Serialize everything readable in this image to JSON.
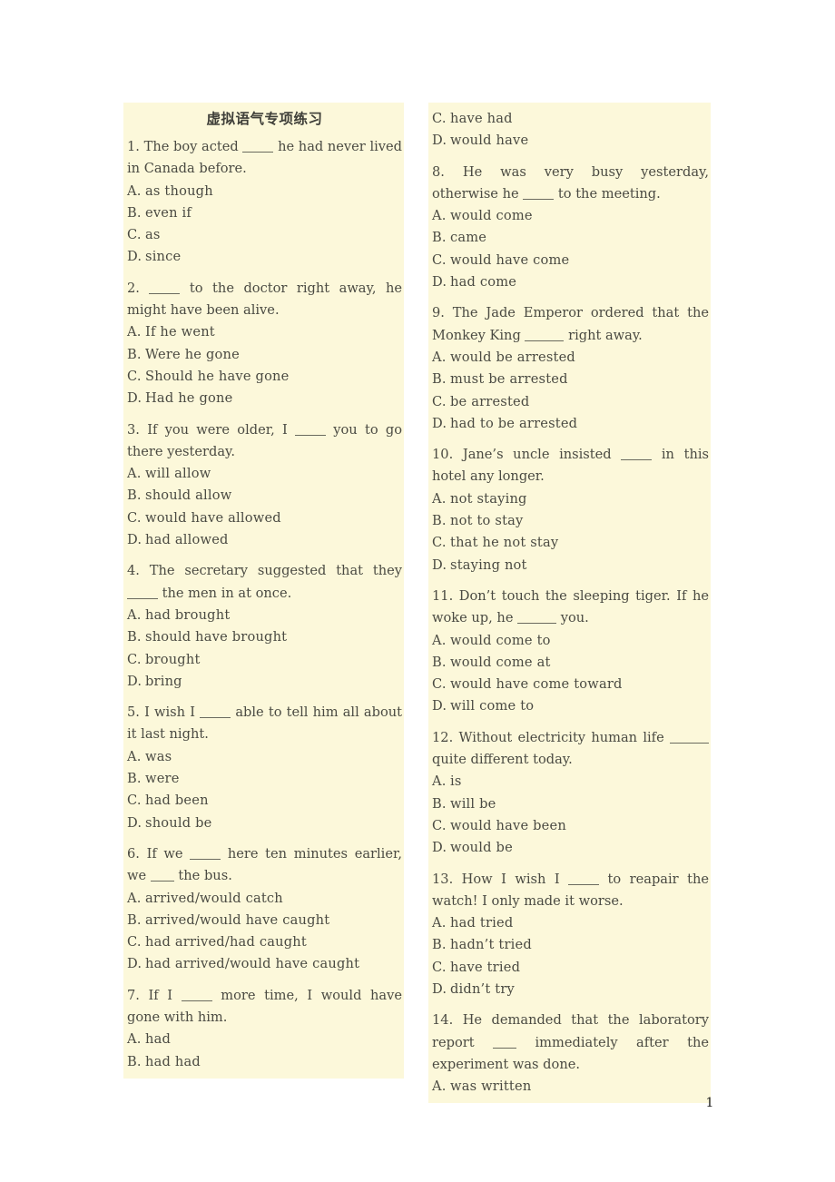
{
  "document": {
    "title": "虚拟语气专项练习",
    "page_number": "1",
    "tint_color": "#fcf8da",
    "text_color": "#4a4a42"
  },
  "columns": {
    "left": {
      "questions": [
        {
          "number": "1.",
          "stem_before": "The boy acted ",
          "blank": "w4",
          "stem_after": " he had never lived in Canada before.",
          "options": [
            {
              "letter": "A.",
              "text": "as though"
            },
            {
              "letter": "B.",
              "text": "even if"
            },
            {
              "letter": "C.",
              "text": "as"
            },
            {
              "letter": "D.",
              "text": "since"
            }
          ]
        },
        {
          "number": "2.",
          "stem_before": "",
          "blank": "w4",
          "stem_after": " to the doctor right away, he might have been alive.",
          "options": [
            {
              "letter": "A.",
              "text": "If he went"
            },
            {
              "letter": "B.",
              "text": "Were he gone"
            },
            {
              "letter": "C.",
              "text": "Should he have gone"
            },
            {
              "letter": "D.",
              "text": "Had he gone"
            }
          ]
        },
        {
          "number": "3.",
          "stem_before": "If you were older, I ",
          "blank": "w4",
          "stem_after": " you to go there yesterday.",
          "options": [
            {
              "letter": "A.",
              "text": "will allow"
            },
            {
              "letter": "B.",
              "text": "should allow"
            },
            {
              "letter": "C.",
              "text": "would have allowed"
            },
            {
              "letter": "D.",
              "text": "had allowed"
            }
          ]
        },
        {
          "number": "4.",
          "stem_before": "The secretary suggested that they ",
          "blank": "w4",
          "stem_after": " the men in at once.",
          "options": [
            {
              "letter": "A.",
              "text": "had brought"
            },
            {
              "letter": "B.",
              "text": "should have brought"
            },
            {
              "letter": "C.",
              "text": "brought"
            },
            {
              "letter": "D.",
              "text": "bring"
            }
          ]
        },
        {
          "number": "5.",
          "stem_before": "I wish I ",
          "blank": "w4",
          "stem_after": " able to tell him all about it last night.",
          "options": [
            {
              "letter": "A.",
              "text": "was"
            },
            {
              "letter": "B.",
              "text": "were"
            },
            {
              "letter": "C.",
              "text": "had been"
            },
            {
              "letter": "D.",
              "text": "should be"
            }
          ]
        },
        {
          "number": "6.",
          "stem_before": "If we ",
          "blank": "w4",
          "stem_mid": " here ten minutes earlier, we ",
          "blank2": "w3",
          "stem_after": " the bus.",
          "options": [
            {
              "letter": "A.",
              "text": "arrived/would catch"
            },
            {
              "letter": "B.",
              "text": "arrived/would have caught"
            },
            {
              "letter": "C.",
              "text": "had arrived/had caught"
            },
            {
              "letter": "D.",
              "text": "had arrived/would have caught"
            }
          ]
        },
        {
          "number": "7.",
          "stem_before": "If I ",
          "blank": "w4",
          "stem_after": " more time, I would have gone with him.",
          "options": [
            {
              "letter": "A.",
              "text": "had"
            },
            {
              "letter": "B.",
              "text": "had had"
            }
          ]
        }
      ]
    },
    "right": {
      "continued_options": [
        {
          "letter": "C.",
          "text": "have had"
        },
        {
          "letter": "D.",
          "text": "would have"
        }
      ],
      "questions": [
        {
          "number": "8.",
          "stem_before": "He was very busy yesterday, otherwise he ",
          "blank": "w4",
          "stem_after": " to the meeting.",
          "options": [
            {
              "letter": "A.",
              "text": "would come"
            },
            {
              "letter": "B.",
              "text": "came"
            },
            {
              "letter": "C.",
              "text": "would have come"
            },
            {
              "letter": "D.",
              "text": "had come"
            }
          ]
        },
        {
          "number": "9.",
          "stem_before": "The Jade Emperor ordered that the Monkey King ",
          "blank": "w5",
          "stem_after": " right away.",
          "options": [
            {
              "letter": "A.",
              "text": "would be arrested"
            },
            {
              "letter": "B.",
              "text": "must be arrested"
            },
            {
              "letter": "C.",
              "text": "be arrested"
            },
            {
              "letter": "D.",
              "text": "had to be arrested"
            }
          ]
        },
        {
          "number": "10.",
          "stem_before": "Jane’s uncle insisted ",
          "blank": "w4",
          "stem_after": " in this hotel any longer.",
          "options": [
            {
              "letter": "A.",
              "text": "not staying"
            },
            {
              "letter": "B.",
              "text": "not to stay"
            },
            {
              "letter": "C.",
              "text": "that he not stay"
            },
            {
              "letter": "D.",
              "text": "staying not"
            }
          ]
        },
        {
          "number": "11.",
          "stem_before": "Don’t touch the sleeping tiger. If he woke up, he ",
          "blank": "w5",
          "stem_after": " you.",
          "options": [
            {
              "letter": "A.",
              "text": "would come to"
            },
            {
              "letter": "B.",
              "text": "would come at"
            },
            {
              "letter": "C.",
              "text": "would have come toward"
            },
            {
              "letter": "D.",
              "text": "will come to"
            }
          ]
        },
        {
          "number": "12.",
          "stem_before": "Without electricity human life ",
          "blank": "w5",
          "stem_after": " quite different today.",
          "options": [
            {
              "letter": "A.",
              "text": "is"
            },
            {
              "letter": "B.",
              "text": "will be"
            },
            {
              "letter": "C.",
              "text": "would have been"
            },
            {
              "letter": "D.",
              "text": "would be"
            }
          ]
        },
        {
          "number": "13.",
          "stem_before": "How I wish I ",
          "blank": "w4",
          "stem_after": " to reapair the watch! I only made it worse.",
          "options": [
            {
              "letter": "A.",
              "text": "had tried"
            },
            {
              "letter": "B.",
              "text": "hadn’t tried"
            },
            {
              "letter": "C.",
              "text": "have tried"
            },
            {
              "letter": "D.",
              "text": "didn’t try"
            }
          ]
        },
        {
          "number": "14.",
          "stem_before": "He demanded that the laboratory report ",
          "blank": "w3",
          "stem_after": " immediately after the experiment was done.",
          "options": [
            {
              "letter": "A.",
              "text": "was written"
            }
          ]
        }
      ]
    }
  }
}
